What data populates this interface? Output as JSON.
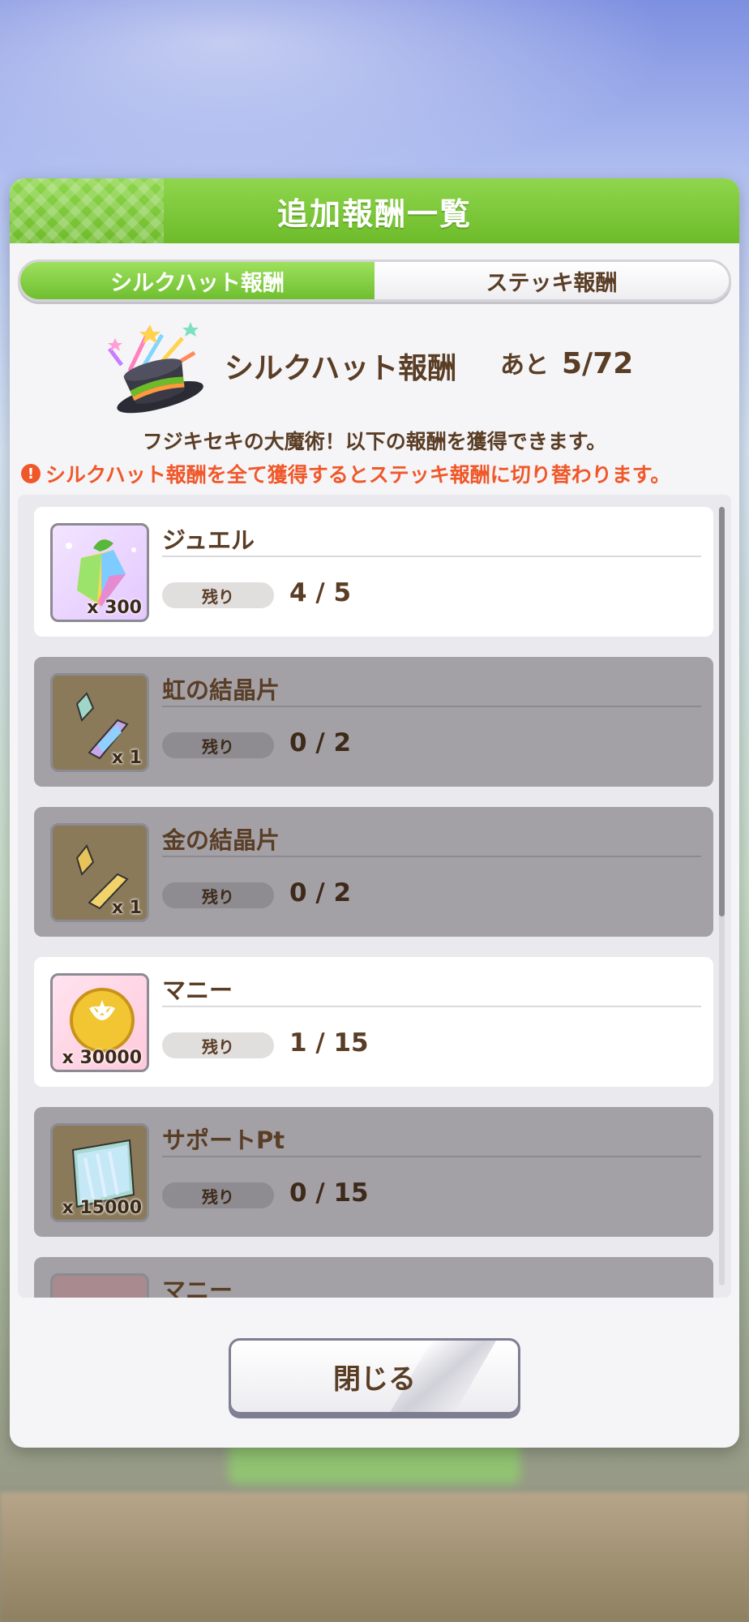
{
  "dialog": {
    "title": "追加報酬一覧",
    "close_label": "閉じる"
  },
  "tabs": [
    {
      "label": "シルクハット報酬",
      "active": true
    },
    {
      "label": "ステッキ報酬",
      "active": false
    }
  ],
  "summary": {
    "icon": "silk-hat-icon",
    "title": "シルクハット報酬",
    "remaining_prefix": "あと",
    "remaining_value": "5/72",
    "description": "フジキセキの大魔術！以下の報酬を獲得できます。",
    "warning": "シルクハット報酬を全て獲得するとステッキ報酬に切り替わります。"
  },
  "remain_label": "残り",
  "rewards": [
    {
      "name": "ジュエル",
      "icon": "jewel-icon",
      "quantity": "x 300",
      "remaining": "4 / 5",
      "completed": false
    },
    {
      "name": "虹の結晶片",
      "icon": "rainbow-crystal-icon",
      "quantity": "x 1",
      "remaining": "0 / 2",
      "completed": true
    },
    {
      "name": "金の結晶片",
      "icon": "gold-crystal-icon",
      "quantity": "x 1",
      "remaining": "0 / 2",
      "completed": true
    },
    {
      "name": "マニー",
      "icon": "money-coin-icon",
      "quantity": "x 30000",
      "remaining": "1 / 15",
      "completed": false
    },
    {
      "name": "サポートPt",
      "icon": "support-pt-icon",
      "quantity": "x 15000",
      "remaining": "0 / 15",
      "completed": true
    },
    {
      "name": "マニー",
      "icon": "money-coin-icon",
      "quantity": "",
      "remaining": "",
      "completed": true
    }
  ],
  "colors": {
    "header_green": "#7cc83a",
    "text_brown": "#5a3d25",
    "warning_orange": "#f0582a",
    "completed_gray": "#a3a1a6"
  }
}
